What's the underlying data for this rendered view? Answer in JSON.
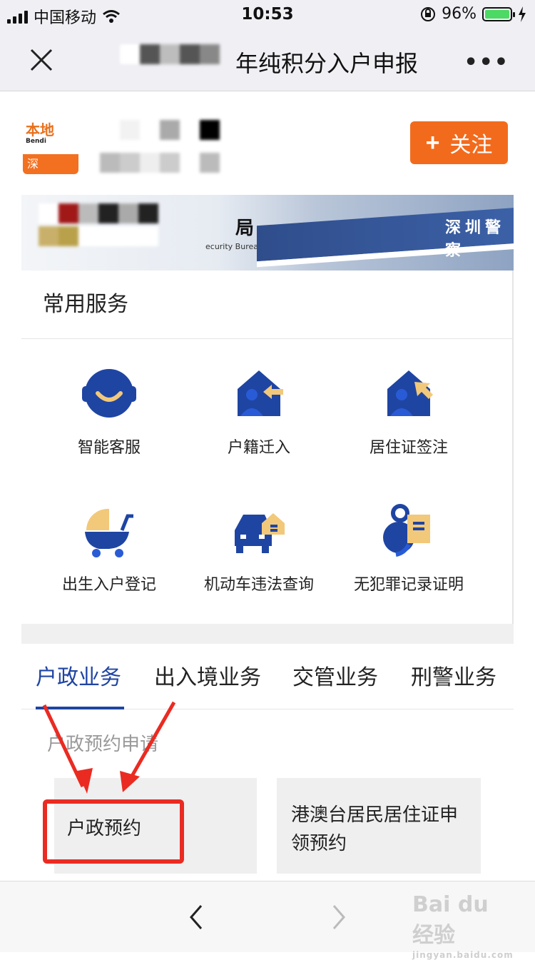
{
  "status_bar": {
    "carrier": "中国移动",
    "time": "10:53",
    "battery": "96%"
  },
  "nav": {
    "title": "年纯积分入户申报"
  },
  "account": {
    "follow_label": "关注",
    "logo_text": "本地",
    "logo_sub": "Bendi",
    "logo_bottom": "深"
  },
  "banner": {
    "bureau_char": "局",
    "bureau_en": "ecurity Bureau",
    "sign_text": "深圳警察"
  },
  "services": {
    "heading": "常用服务",
    "items": [
      {
        "label": "智能客服",
        "icon": "customer-service-icon"
      },
      {
        "label": "户籍迁入",
        "icon": "house-arrow-in-icon"
      },
      {
        "label": "居住证签注",
        "icon": "house-pointer-icon"
      },
      {
        "label": "出生入户登记",
        "icon": "stroller-icon"
      },
      {
        "label": "机动车违法查询",
        "icon": "car-house-icon"
      },
      {
        "label": "无犯罪记录证明",
        "icon": "document-shield-icon"
      }
    ]
  },
  "tabs": [
    {
      "label": "户政业务",
      "active": true
    },
    {
      "label": "出入境业务",
      "active": false
    },
    {
      "label": "交管业务",
      "active": false
    },
    {
      "label": "刑警业务",
      "active": false
    }
  ],
  "section": {
    "label": "户政预约申请"
  },
  "cards": [
    {
      "label": "户政预约"
    },
    {
      "label": "港澳台居民居住证申领预约"
    }
  ],
  "watermark": {
    "big": "Bai du 经验",
    "small": "jingyan.baidu.com"
  },
  "colors": {
    "accent": "#1f45a3",
    "follow": "#f26b1d",
    "highlight": "#ea2b22",
    "icon_blue": "#1f45a3",
    "icon_yellow": "#f2c97a"
  }
}
